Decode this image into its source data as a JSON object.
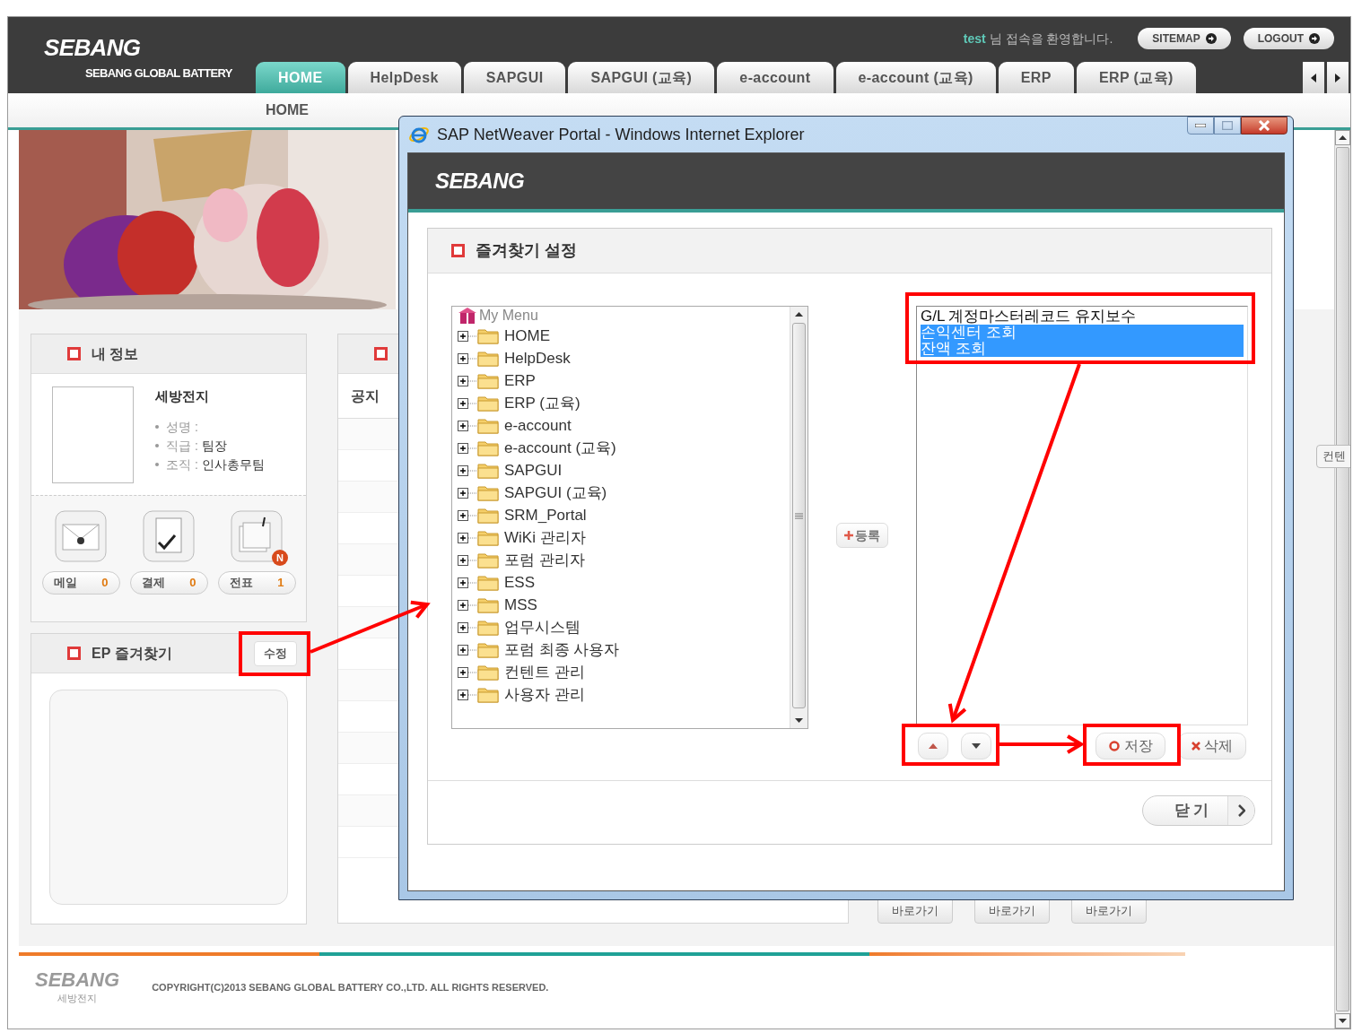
{
  "header": {
    "logo": "SEBANG",
    "subtitle": "SEBANG GLOBAL BATTERY",
    "welcome_user": "test",
    "welcome_text": "님 접속을 환영합니다.",
    "buttons": [
      "SITEMAP",
      "LOGOUT"
    ]
  },
  "tabs": [
    {
      "label": "HOME",
      "selected": true
    },
    {
      "label": "HelpDesk",
      "selected": false
    },
    {
      "label": "SAPGUI",
      "selected": false
    },
    {
      "label": "SAPGUI (교육)",
      "selected": false
    },
    {
      "label": "e-account",
      "selected": false
    },
    {
      "label": "e-account (교육)",
      "selected": false
    },
    {
      "label": "ERP",
      "selected": false
    },
    {
      "label": "ERP (교육)",
      "selected": false
    }
  ],
  "breadcrumb": "HOME",
  "my_info": {
    "title": "내 정보",
    "company": "세방전지",
    "fields": [
      {
        "label": "성명 :"
      },
      {
        "label": "직급 :",
        "value": "팀장"
      },
      {
        "label": "조직 :",
        "value": "인사총무팀"
      }
    ],
    "shortcuts": [
      {
        "kind": "mail",
        "label": "메일",
        "count": "0"
      },
      {
        "kind": "approval",
        "label": "결제",
        "count": "0"
      },
      {
        "kind": "slip",
        "label": "전표",
        "count": "1",
        "badge": "N"
      }
    ]
  },
  "favorites": {
    "title": "EP 즐겨찾기",
    "edit_button": "수정"
  },
  "notice_panel": {
    "tab": "공지"
  },
  "shortcut_buttons": [
    "바로가기",
    "바로가기",
    "바로가기"
  ],
  "side_tab": "컨텐",
  "footer": {
    "logo": "SEBANG",
    "logo_caption": "세방전지",
    "copyright": "COPYRIGHT(C)2013  SEBANG GLOBAL BATTERY CO.,LTD. ALL RIGHTS RESERVED."
  },
  "popup": {
    "title": "SAP NetWeaver Portal - Windows Internet Explorer",
    "logo": "SEBANG",
    "heading": "즐겨찾기 설정",
    "tree": {
      "label": "My Menu",
      "children": [
        {
          "label": "HOME",
          "expanded": false
        },
        {
          "label": "HelpDesk",
          "expanded": false
        },
        {
          "label": "ERP",
          "expanded": false
        },
        {
          "label": "ERP (교육)",
          "expanded": false
        },
        {
          "label": "e-account",
          "expanded": false
        },
        {
          "label": "e-account (교육)",
          "expanded": false
        },
        {
          "label": "SAPGUI",
          "expanded": false
        },
        {
          "label": "SAPGUI (교육)",
          "expanded": false
        },
        {
          "label": "SRM_Portal",
          "expanded": false
        },
        {
          "label": "WiKi 관리자",
          "expanded": false
        },
        {
          "label": "포럼 관리자",
          "expanded": false
        },
        {
          "label": "ESS",
          "expanded": false
        },
        {
          "label": "MSS",
          "expanded": false
        },
        {
          "label": "업무시스템",
          "expanded": false
        },
        {
          "label": "포럼 최종 사용자",
          "expanded": false
        },
        {
          "label": "컨텐트 관리",
          "expanded": false
        },
        {
          "label": "사용자 관리",
          "expanded": false
        }
      ]
    },
    "add_button": "등록",
    "selected_list": [
      {
        "label": "G/L 계정마스터레코드 유지보수",
        "selected": false
      },
      {
        "label": "손익센터 조회",
        "selected": true
      },
      {
        "label": "잔액 조회",
        "selected": true
      }
    ],
    "save_button": "저장",
    "delete_button": "삭제",
    "close_button": "닫 기"
  }
}
